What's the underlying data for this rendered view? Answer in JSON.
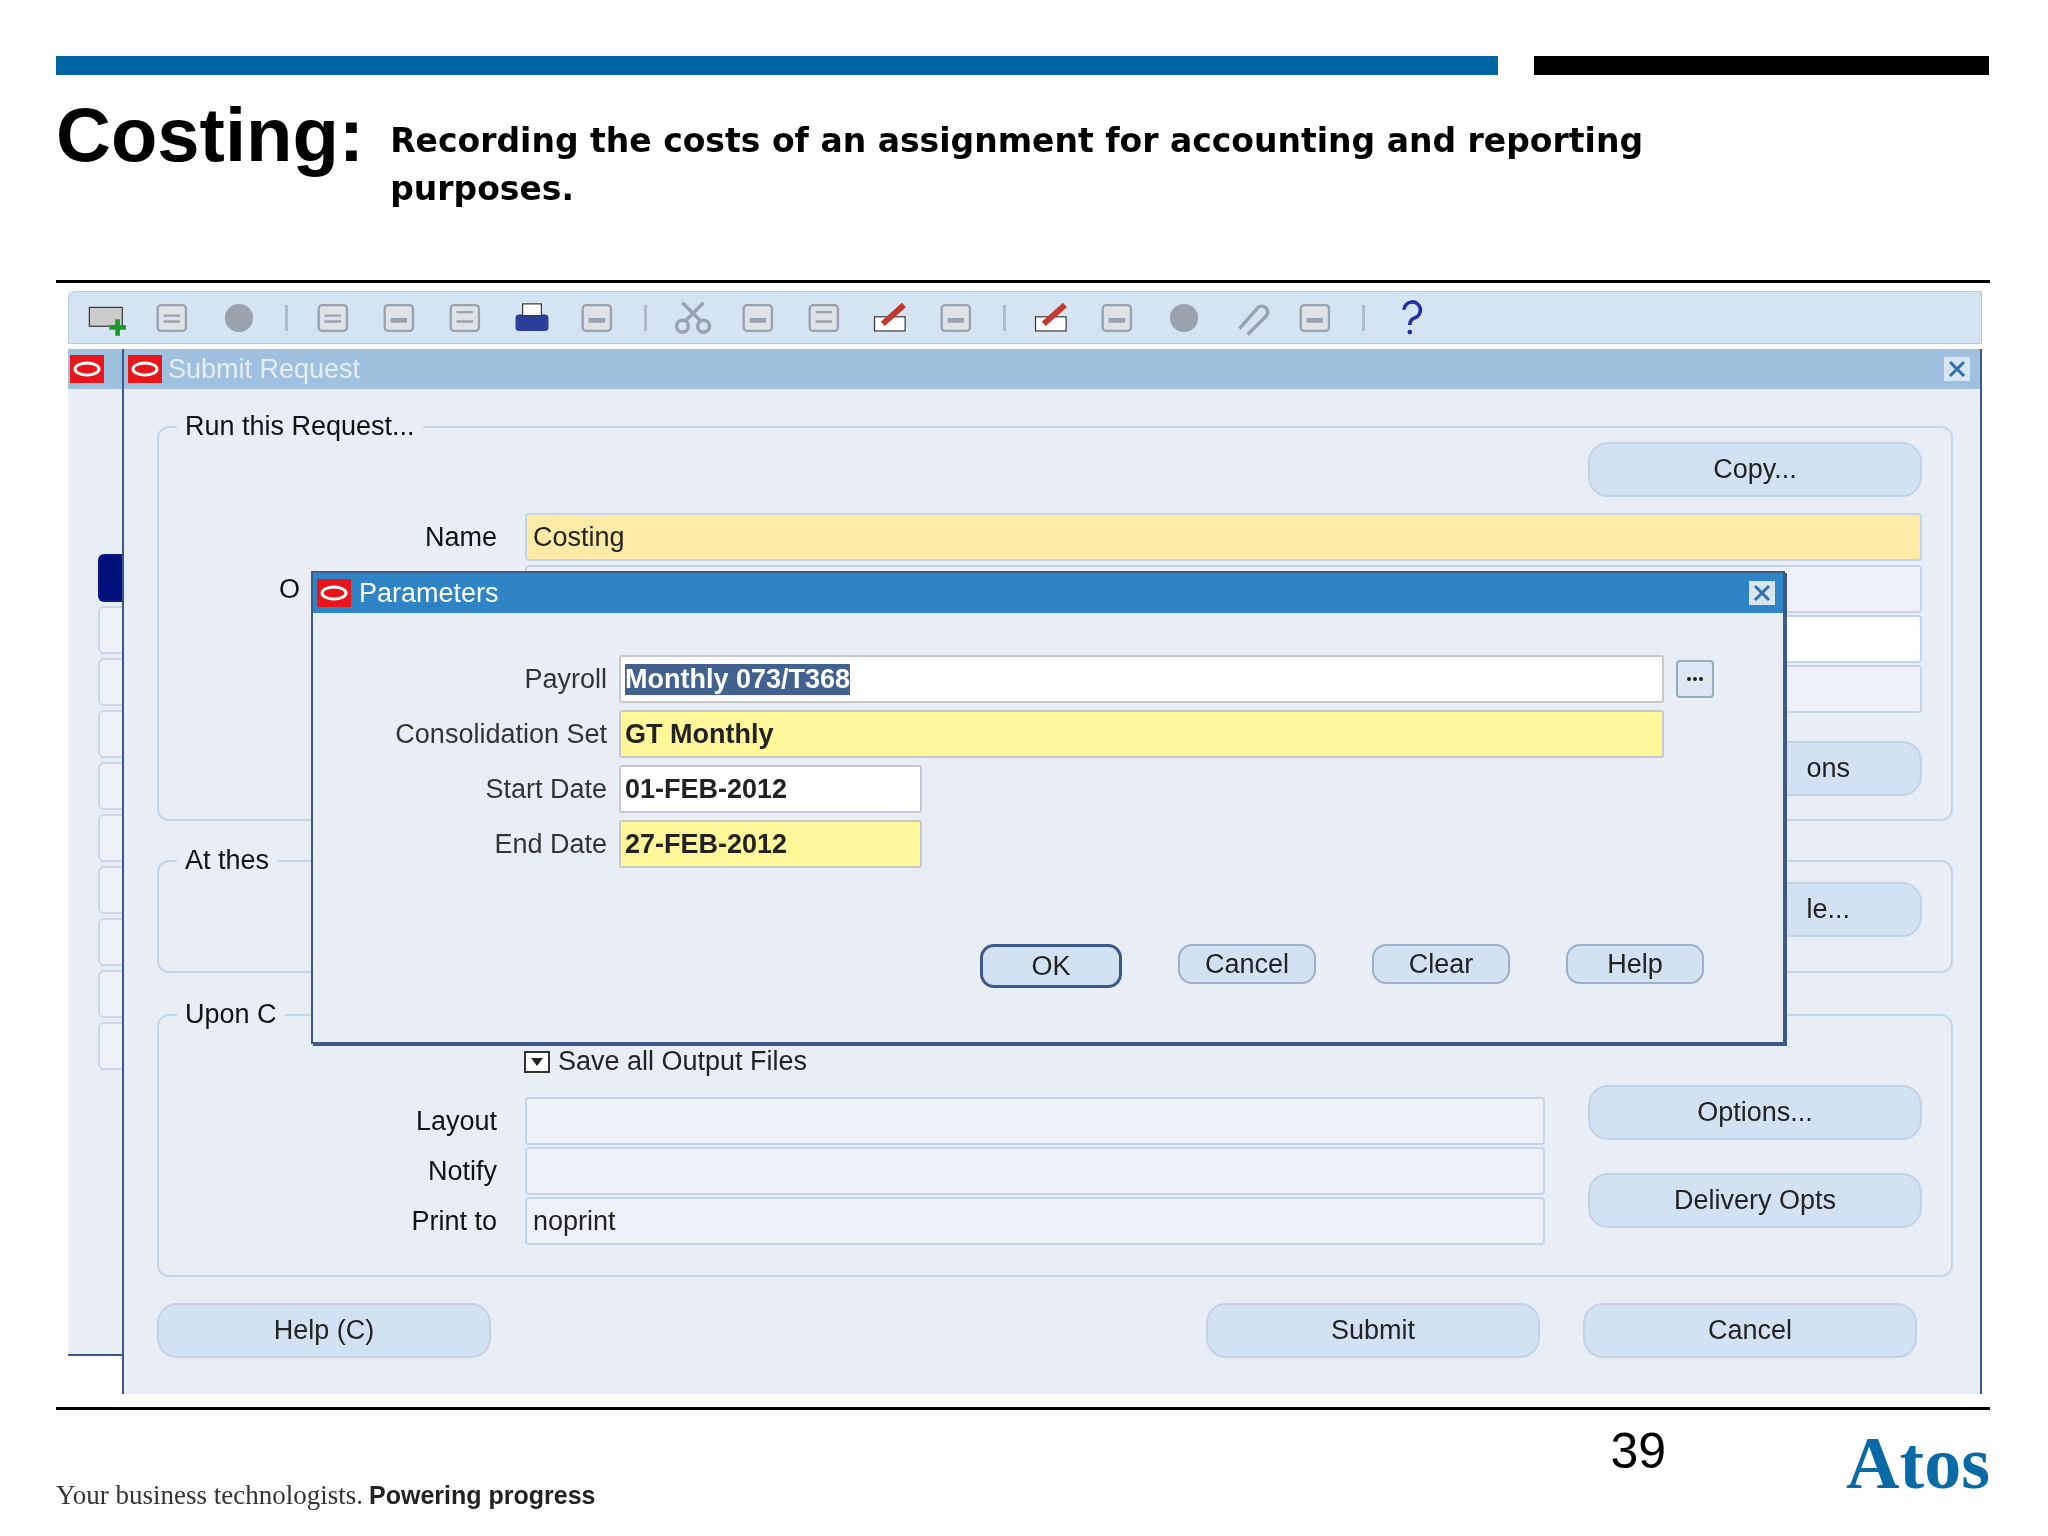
{
  "slide": {
    "title": "Costing:",
    "subtitle": "Recording the costs of an assignment for accounting and reporting purposes.",
    "page_number": "39",
    "tagline_lead": "Your business technologists.",
    "tagline_bold": "Powering progress",
    "logo": "Atos"
  },
  "side_tabs": [
    {
      "selected": true
    },
    {
      "selected": false
    },
    {
      "selected": false
    },
    {
      "selected": false
    },
    {
      "selected": false
    },
    {
      "selected": false
    },
    {
      "selected": false
    },
    {
      "selected": false
    },
    {
      "selected": false
    },
    {
      "selected": false
    }
  ],
  "window": {
    "title": "Submit Request"
  },
  "run_group": {
    "legend": "Run this Request...",
    "copy_button": "Copy...",
    "name_label": "Name",
    "name_value": "Costing",
    "row_2_label": "O",
    "options_button": "ons"
  },
  "schedule_group": {
    "legend": "At thes",
    "button": "le..."
  },
  "completion_group": {
    "legend": "Upon C",
    "save_output": {
      "label": "Save all Output Files",
      "checked": true
    },
    "fields": [
      {
        "label": "Layout"
      },
      {
        "label": "Notify"
      },
      {
        "label": "Print to",
        "value": "noprint"
      }
    ],
    "buttons": [
      {
        "label": "Options..."
      },
      {
        "label": "Delivery Opts"
      }
    ]
  },
  "footer_buttons": [
    {
      "label": "Help (C)"
    },
    {
      "label": "Submit"
    },
    {
      "label": "Cancel"
    }
  ],
  "dialog": {
    "title": "Parameters",
    "fields": [
      {
        "label": "Payroll",
        "value": "Monthly 073/T368",
        "kind": "long",
        "required": false,
        "text_selected": true,
        "lov": true
      },
      {
        "label": "Consolidation Set",
        "value": "GT Monthly",
        "kind": "long",
        "required": true,
        "text_selected": false,
        "lov": false
      },
      {
        "label": "Start Date",
        "value": "01-FEB-2012",
        "kind": "date",
        "required": false,
        "text_selected": false,
        "lov": false
      },
      {
        "label": "End Date",
        "value": "27-FEB-2012",
        "kind": "date",
        "required": true,
        "text_selected": false,
        "lov": false
      }
    ],
    "buttons": [
      {
        "label": "OK",
        "default": true
      },
      {
        "label": "Cancel",
        "default": false
      },
      {
        "label": "Clear",
        "default": false
      },
      {
        "label": "Help",
        "default": false
      }
    ]
  }
}
